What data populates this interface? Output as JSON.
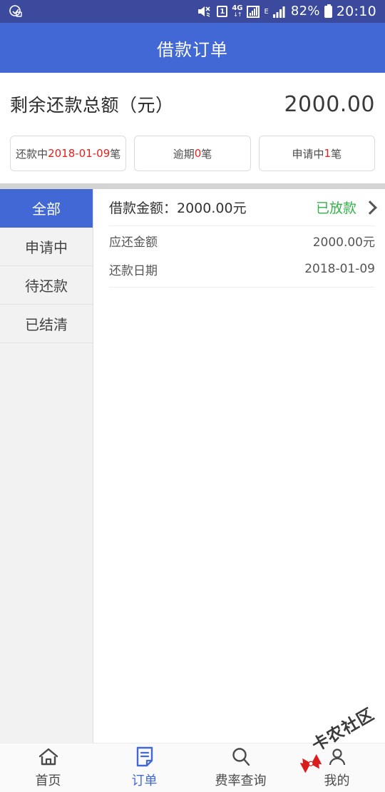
{
  "statusbar": {
    "left_icon": "app-notification-icon",
    "icons": [
      "mute-icon",
      "sim-card-icon",
      "4g-data-icon",
      "signal-strength-icon",
      "edge-network-icon",
      "signal-bars-icon"
    ],
    "sim_label": "1",
    "net_label": "4G",
    "edge_label": "E",
    "battery_percent": "82%",
    "time": "20:10"
  },
  "header": {
    "title": "借款订单"
  },
  "summary": {
    "label": "剩余还款总额（元）",
    "value": "2000.00",
    "chips": [
      {
        "prefix": "还款中",
        "highlight": "2018-01-09",
        "suffix": "笔"
      },
      {
        "prefix": "逾期",
        "highlight": "0",
        "suffix": "笔"
      },
      {
        "prefix": "申请中",
        "highlight": "1",
        "suffix": "笔"
      }
    ]
  },
  "sidebar": {
    "items": [
      {
        "label": "全部",
        "active": true
      },
      {
        "label": "申请中",
        "active": false
      },
      {
        "label": "待还款",
        "active": false
      },
      {
        "label": "已结清",
        "active": false
      }
    ]
  },
  "order": {
    "title": "借款金额：2000.00元",
    "status": "已放款",
    "chevron": "chevron-right-icon",
    "rows": [
      {
        "key": "应还金额",
        "value": "2000.00元"
      },
      {
        "key": "还款日期",
        "value": "2018-01-09"
      }
    ]
  },
  "tabbar": {
    "items": [
      {
        "label": "首页",
        "icon": "home-icon",
        "active": false
      },
      {
        "label": "订单",
        "icon": "document-icon",
        "active": true
      },
      {
        "label": "费率查询",
        "icon": "search-icon",
        "active": false
      },
      {
        "label": "我的",
        "icon": "user-icon",
        "active": false
      }
    ]
  },
  "watermark": {
    "text": "卡农社区",
    "logo": "bowtie-logo-icon"
  },
  "colors": {
    "statusbar": "#3b4a9c",
    "header": "#4268d6",
    "accent": "#4268d6",
    "highlight_red": "#e8201c",
    "status_green": "#35b34a",
    "sidebar_bg": "#f2f2f2"
  }
}
